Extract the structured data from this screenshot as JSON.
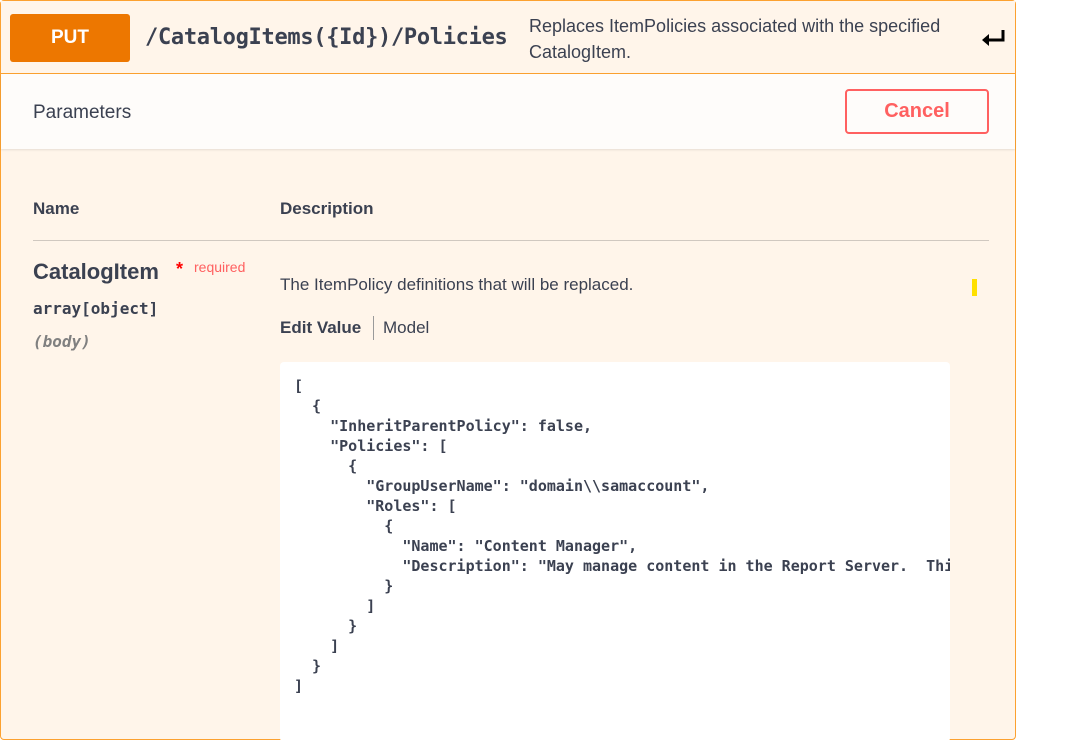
{
  "operation": {
    "method": "PUT",
    "path": "/CatalogItems({Id})/Policies",
    "summary": "Replaces ItemPolicies associated with the specified CatalogItem.",
    "expand_icon": "enter-return-icon"
  },
  "parameters_section": {
    "title": "Parameters",
    "cancel_label": "Cancel",
    "columns": {
      "name": "Name",
      "description": "Description"
    }
  },
  "parameter": {
    "name": "CatalogItem",
    "required_star": "*",
    "required_label": "required",
    "type": "array[object]",
    "location": "(body)",
    "description": "The ItemPolicy definitions that will be replaced.",
    "tabs": {
      "edit_value": "Edit Value",
      "model": "Model"
    },
    "body_value": "[\n  {\n    \"InheritParentPolicy\": false,\n    \"Policies\": [\n      {\n        \"GroupUserName\": \"domain\\\\samaccount\",\n        \"Roles\": [\n          {\n            \"Name\": \"Content Manager\",\n            \"Description\": \"May manage content in the Report Server.  This includes folders, reports and resources.\"\n          }\n        ]\n      }\n    ]\n  }\n]"
  },
  "colors": {
    "method_put": "#ed7700",
    "opblock_border": "#fca130",
    "opblock_background": "#fff5ea",
    "cancel": "#ff6060",
    "required": "#ff0000"
  }
}
